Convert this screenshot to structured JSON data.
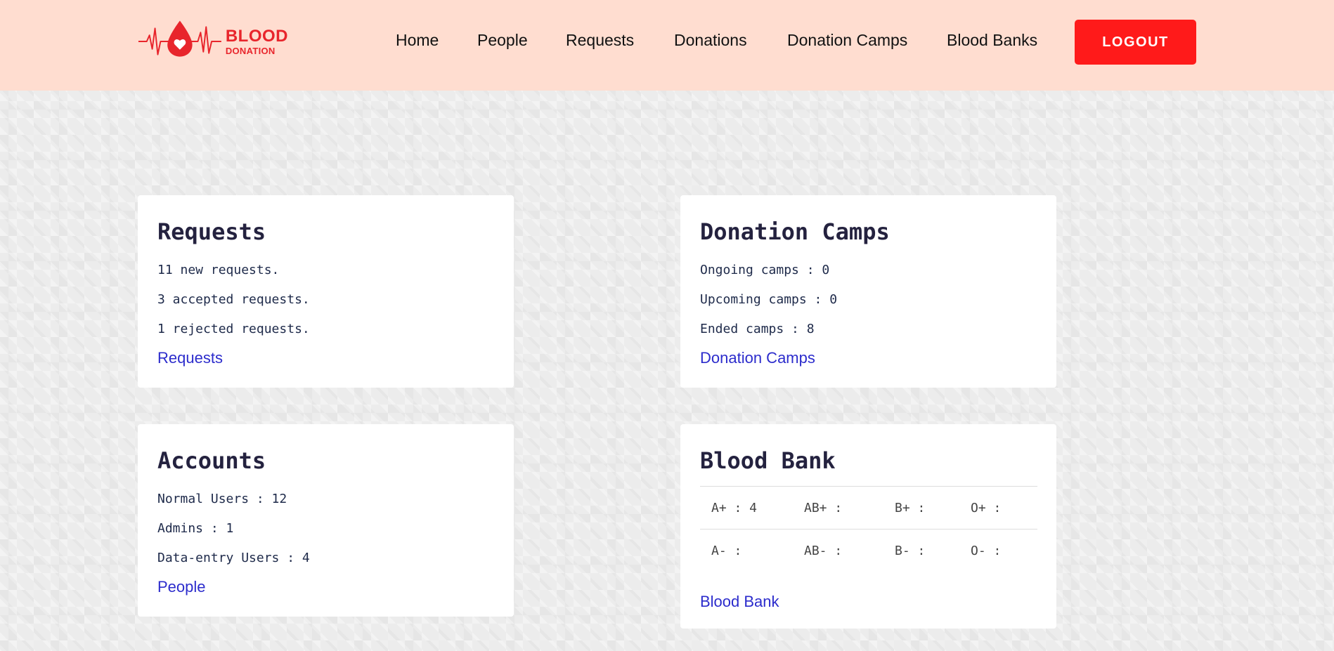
{
  "brand": {
    "line1": "BLOOD",
    "line2": "DONATION",
    "color": "#e8252c"
  },
  "nav": {
    "items": [
      {
        "label": "Home"
      },
      {
        "label": "People"
      },
      {
        "label": "Requests"
      },
      {
        "label": "Donations"
      },
      {
        "label": "Donation Camps"
      },
      {
        "label": "Blood Banks"
      }
    ],
    "logout_label": "LOGOUT"
  },
  "colors": {
    "header_bg": "#ffddd0",
    "accent": "#ff1a1a",
    "link": "#2c2ccc",
    "heading": "#24223f"
  },
  "cards": {
    "requests": {
      "title": "Requests",
      "lines": [
        "11 new requests.",
        "3 accepted requests.",
        "1 rejected requests."
      ],
      "link": "Requests"
    },
    "camps": {
      "title": "Donation Camps",
      "lines": [
        "Ongoing camps : 0",
        "Upcoming camps : 0",
        "Ended camps : 8"
      ],
      "link": "Donation Camps"
    },
    "accounts": {
      "title": "Accounts",
      "lines": [
        "Normal Users : 12",
        "Admins : 1",
        "Data-entry Users : 4"
      ],
      "link": "People"
    },
    "blood_bank": {
      "title": "Blood Bank",
      "rows": [
        [
          "A+ : 4",
          "AB+ :",
          "B+ :",
          "O+ :"
        ],
        [
          "A- :",
          "AB- :",
          "B- :",
          "O- :"
        ]
      ],
      "link": "Blood Bank"
    }
  }
}
